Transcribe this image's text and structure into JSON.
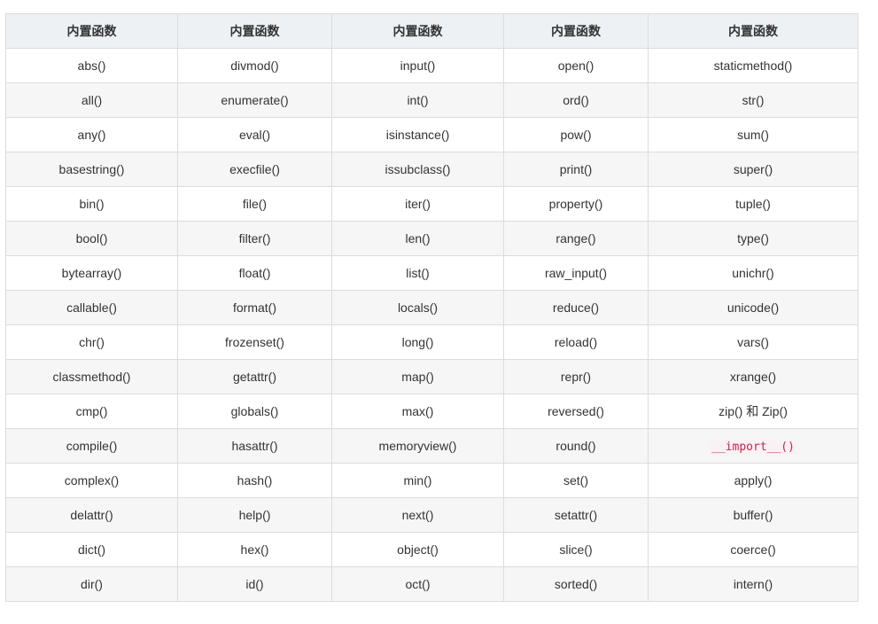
{
  "table": {
    "headers": [
      "内置函数",
      "内置函数",
      "内置函数",
      "内置函数",
      "内置函数"
    ],
    "rows": [
      [
        "abs()",
        "divmod()",
        "input()",
        "open()",
        "staticmethod()"
      ],
      [
        "all()",
        "enumerate()",
        "int()",
        "ord()",
        "str()"
      ],
      [
        "any()",
        "eval()",
        "isinstance()",
        "pow()",
        "sum()"
      ],
      [
        "basestring()",
        "execfile()",
        "issubclass()",
        "print()",
        "super()"
      ],
      [
        "bin()",
        "file()",
        "iter()",
        "property()",
        "tuple()"
      ],
      [
        "bool()",
        "filter()",
        "len()",
        "range()",
        "type()"
      ],
      [
        "bytearray()",
        "float()",
        "list()",
        "raw_input()",
        "unichr()"
      ],
      [
        "callable()",
        "format()",
        "locals()",
        "reduce()",
        "unicode()"
      ],
      [
        "chr()",
        "frozenset()",
        "long()",
        "reload()",
        "vars()"
      ],
      [
        "classmethod()",
        "getattr()",
        "map()",
        "repr()",
        "xrange()"
      ],
      [
        "cmp()",
        "globals()",
        "max()",
        "reversed()",
        "zip() 和 Zip()"
      ],
      [
        "compile()",
        "hasattr()",
        "memoryview()",
        "round()",
        "__import__()"
      ],
      [
        "complex()",
        "hash()",
        "min()",
        "set()",
        "apply()"
      ],
      [
        "delattr()",
        "help()",
        "next()",
        "setattr()",
        "buffer()"
      ],
      [
        "dict()",
        "hex()",
        "object()",
        "slice()",
        "coerce()"
      ],
      [
        "dir()",
        "id()",
        "oct()",
        "sorted()",
        "intern()"
      ]
    ],
    "code_cells": [
      "11.4"
    ]
  },
  "colors": {
    "header_bg": "#eef1f4",
    "stripe_bg": "#f6f6f6",
    "border": "#dcdcdc",
    "code_text": "#c7254e"
  }
}
